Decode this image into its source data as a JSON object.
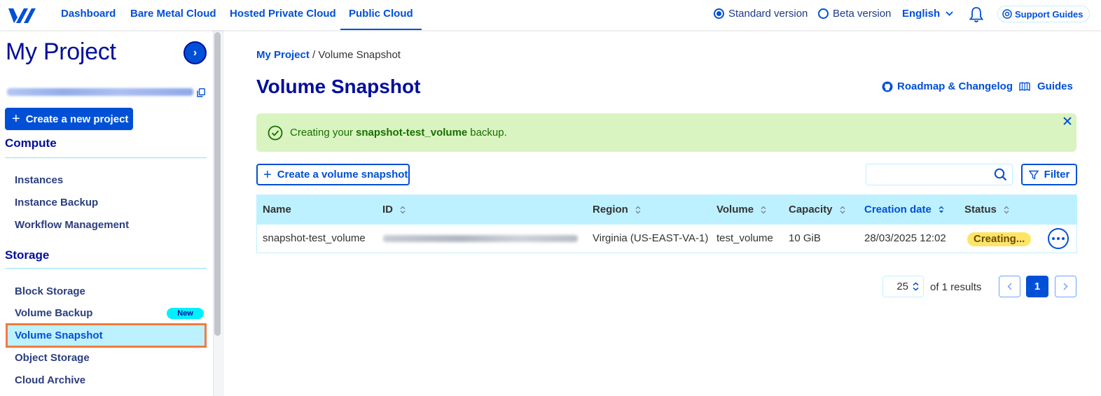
{
  "topnav": {
    "items": [
      "Dashboard",
      "Bare Metal Cloud",
      "Hosted Private Cloud",
      "Public Cloud"
    ],
    "active": "Public Cloud",
    "standard_version": "Standard version",
    "beta_version": "Beta version",
    "version_selected": "Standard version",
    "language": "English",
    "support": "Support Guides"
  },
  "sidebar": {
    "project_title": "My Project",
    "new_project": "Create a new project",
    "sections": [
      {
        "title": "Compute",
        "items": [
          "Instances",
          "Instance Backup",
          "Workflow Management"
        ]
      },
      {
        "title": "Storage",
        "items": [
          "Block Storage",
          "Volume Backup",
          "Volume Snapshot",
          "Object Storage",
          "Cloud Archive"
        ]
      }
    ],
    "active_item": "Volume Snapshot",
    "badge_new": "New"
  },
  "main": {
    "breadcrumb": {
      "root": "My Project",
      "separator": "/",
      "current": "Volume Snapshot"
    },
    "title": "Volume Snapshot",
    "roadmap_link": "Roadmap & Changelog",
    "guides_link": "Guides",
    "alert": {
      "prefix": "Creating your",
      "name": "snapshot-test_volume",
      "suffix": "backup."
    },
    "create_button": "Create a volume snapshot",
    "search_placeholder": "",
    "filter_button": "Filter",
    "table": {
      "columns": [
        "Name",
        "ID",
        "Region",
        "Volume",
        "Capacity",
        "Creation date",
        "Status"
      ],
      "sorted_column": "Creation date",
      "rows": [
        {
          "name": "snapshot-test_volume",
          "region": "Virginia (US-EAST-VA-1)",
          "volume": "test_volume",
          "capacity": "10 GiB",
          "created": "28/03/2025 12:02",
          "status": "Creating..."
        }
      ]
    },
    "pagination": {
      "page_size": "25",
      "results_text": "of 1 results",
      "current_page": "1"
    }
  },
  "colors": {
    "primary": "#0050d7",
    "dark": "#000e9c",
    "header_bg": "#bef1ff",
    "alert_bg": "#d9f4c0",
    "status_pending": "#ffe567",
    "highlight": "#f07c41"
  }
}
